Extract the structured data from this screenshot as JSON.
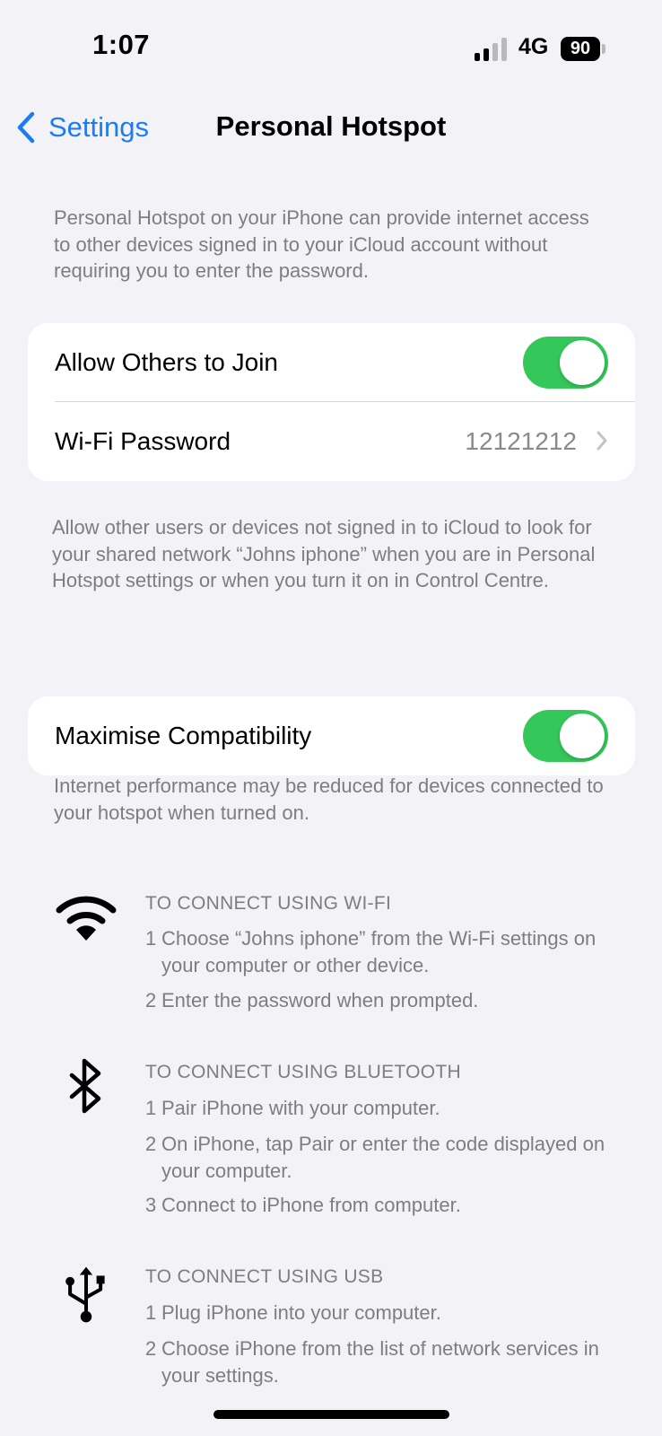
{
  "status_bar": {
    "time": "1:07",
    "network": "4G",
    "battery": "90",
    "signal_bars_active": 2,
    "signal_bars_total": 4
  },
  "nav": {
    "back_label": "Settings",
    "title": "Personal Hotspot"
  },
  "intro_text": "Personal Hotspot on your iPhone can provide internet access to other devices signed in to your iCloud account without requiring you to enter the password.",
  "section1": {
    "allow_label": "Allow Others to Join",
    "allow_on": true,
    "password_label": "Wi-Fi Password",
    "password_value": "12121212",
    "footer": "Allow other users or devices not signed in to iCloud to look for your shared network “Johns iphone” when you are in Personal Hotspot settings or when you turn it on in Control Centre."
  },
  "section2": {
    "compat_label": "Maximise Compatibility",
    "compat_on": true,
    "footer": "Internet performance may be reduced for devices connected to your hotspot when turned on."
  },
  "instructions": {
    "wifi": {
      "title": "TO CONNECT USING WI-FI",
      "steps": [
        {
          "n": "1",
          "t": "Choose “Johns iphone” from the Wi-Fi settings on your computer or other device."
        },
        {
          "n": "2",
          "t": "Enter the password when prompted."
        }
      ]
    },
    "bluetooth": {
      "title": "TO CONNECT USING BLUETOOTH",
      "steps": [
        {
          "n": "1",
          "t": "Pair iPhone with your computer."
        },
        {
          "n": "2",
          "t": "On iPhone, tap Pair or enter the code displayed on your computer."
        },
        {
          "n": "3",
          "t": "Connect to iPhone from computer."
        }
      ]
    },
    "usb": {
      "title": "TO CONNECT USING USB",
      "steps": [
        {
          "n": "1",
          "t": "Plug iPhone into your computer."
        },
        {
          "n": "2",
          "t": "Choose iPhone from the list of network services in your settings."
        }
      ]
    }
  },
  "colors": {
    "accent": "#1e7cf2",
    "toggle_on": "#34c759",
    "background": "#f2f2f7",
    "secondary_text": "#7d7d82"
  },
  "icons": {
    "back": "chevron-left-icon",
    "wifi": "wifi-icon",
    "bluetooth": "bluetooth-icon",
    "usb": "usb-icon",
    "disclosure": "chevron-right-icon"
  }
}
